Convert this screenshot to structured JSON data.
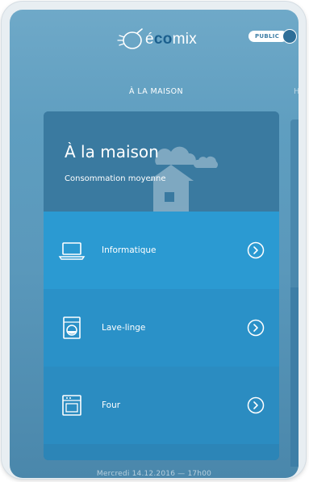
{
  "header": {
    "logo_text_pre": "é",
    "logo_text_accent": "co",
    "logo_text_post": "mix",
    "toggle_label": "PUBLIC"
  },
  "tabs": [
    {
      "label": "À LA MAISON",
      "active": true
    },
    {
      "label": "HA",
      "active": false
    }
  ],
  "card": {
    "title": "À la maison",
    "subtitle": "Consommation moyenne",
    "items": [
      {
        "label": "Informatique",
        "icon": "laptop-icon"
      },
      {
        "label": "Lave-linge",
        "icon": "washing-machine-icon"
      },
      {
        "label": "Four",
        "icon": "oven-icon"
      }
    ]
  },
  "footer": {
    "datetime": "Mercredi 14.12.2016 — 17h00"
  },
  "colors": {
    "background": "#5f9ec0",
    "card_header": "#3a7aa0",
    "row_active": "#2b9ad2",
    "logo_accent": "#1b5f8e"
  }
}
